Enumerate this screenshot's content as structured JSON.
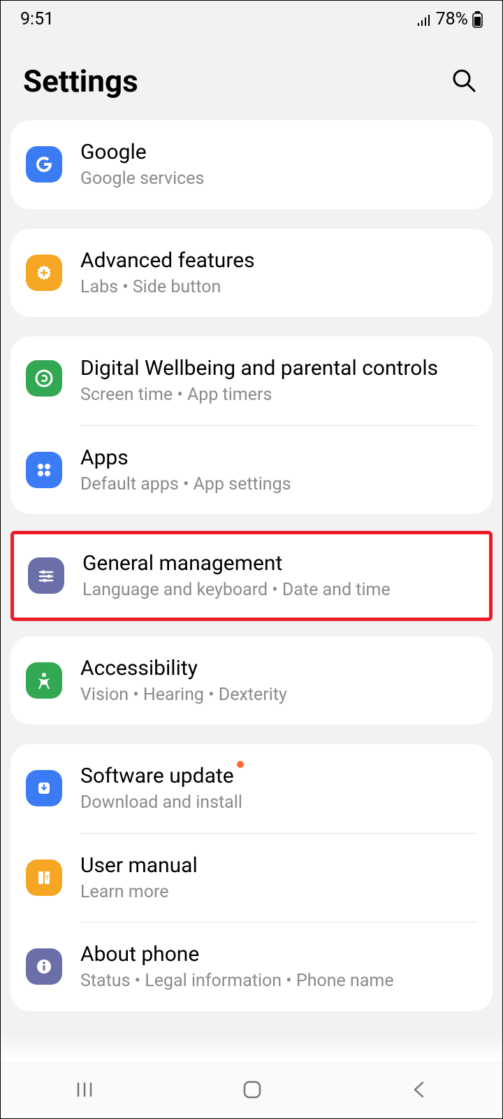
{
  "status": {
    "time": "9:51",
    "battery": "78%"
  },
  "header": {
    "title": "Settings"
  },
  "groups": [
    {
      "rows": [
        {
          "id": "google",
          "icon": "google-icon",
          "color": "ic-blue",
          "title": "Google",
          "sub": "Google services"
        }
      ]
    },
    {
      "rows": [
        {
          "id": "advanced",
          "icon": "gear-plus-icon",
          "color": "ic-orange",
          "title": "Advanced features",
          "sub": "Labs  •  Side button"
        }
      ]
    },
    {
      "rows": [
        {
          "id": "wellbeing",
          "icon": "wellbeing-icon",
          "color": "ic-green",
          "title": "Digital Wellbeing and parental controls",
          "sub": "Screen time  •  App timers",
          "largeIcon": true
        },
        {
          "id": "apps",
          "icon": "apps-icon",
          "color": "ic-blue",
          "title": "Apps",
          "sub": "Default apps  •  App settings"
        }
      ]
    },
    {
      "highlight": true,
      "rows": [
        {
          "id": "general",
          "icon": "sliders-icon",
          "color": "ic-purple",
          "title": "General management",
          "sub": "Language and keyboard  •  Date and time"
        }
      ]
    },
    {
      "rows": [
        {
          "id": "accessibility",
          "icon": "accessibility-icon",
          "color": "ic-green",
          "title": "Accessibility",
          "sub": "Vision  •  Hearing  •  Dexterity"
        }
      ]
    },
    {
      "rows": [
        {
          "id": "update",
          "icon": "download-icon",
          "color": "ic-blue",
          "title": "Software update",
          "sub": "Download and install",
          "badge": true
        },
        {
          "id": "manual",
          "icon": "book-icon",
          "color": "ic-orange",
          "title": "User manual",
          "sub": "Learn more"
        },
        {
          "id": "about",
          "icon": "info-icon",
          "color": "ic-purple",
          "title": "About phone",
          "sub": "Status  •  Legal information  •  Phone name"
        }
      ]
    }
  ]
}
